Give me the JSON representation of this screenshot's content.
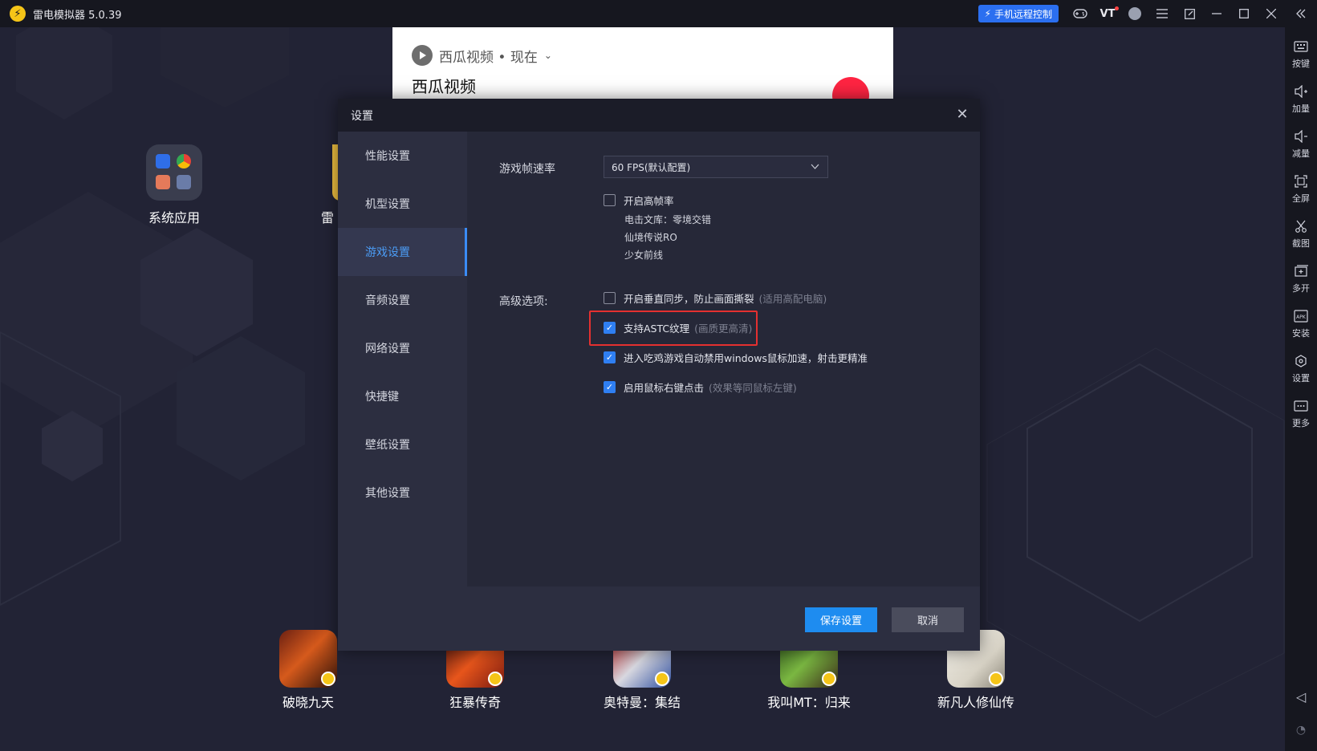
{
  "titlebar": {
    "title": "雷电模拟器 5.0.39",
    "remote_label": "手机远程控制",
    "vt_label": "VT"
  },
  "sidebar": {
    "items": [
      {
        "label": "按键",
        "icon": "keyboard-icon"
      },
      {
        "label": "加量",
        "icon": "volume-up-icon"
      },
      {
        "label": "减量",
        "icon": "volume-down-icon"
      },
      {
        "label": "全屏",
        "icon": "fullscreen-icon"
      },
      {
        "label": "截图",
        "icon": "scissors-icon"
      },
      {
        "label": "多开",
        "icon": "multi-instance-icon"
      },
      {
        "label": "安装",
        "icon": "apk-icon"
      },
      {
        "label": "设置",
        "icon": "gear-icon"
      },
      {
        "label": "更多",
        "icon": "more-icon"
      }
    ]
  },
  "desktop": {
    "folder_label": "系统应用",
    "partial_label": "雷",
    "games": [
      {
        "label": "破晓九天"
      },
      {
        "label": "狂暴传奇"
      },
      {
        "label": "奥特曼：集结"
      },
      {
        "label": "我叫MT：归来"
      },
      {
        "label": "新凡人修仙传"
      }
    ]
  },
  "notification": {
    "source": "西瓜视频 • 现在",
    "title": "西瓜视频"
  },
  "dialog": {
    "title": "设置",
    "nav": [
      {
        "label": "性能设置",
        "active": false
      },
      {
        "label": "机型设置",
        "active": false
      },
      {
        "label": "游戏设置",
        "active": true
      },
      {
        "label": "音频设置",
        "active": false
      },
      {
        "label": "网络设置",
        "active": false
      },
      {
        "label": "快捷键",
        "active": false
      },
      {
        "label": "壁纸设置",
        "active": false
      },
      {
        "label": "其他设置",
        "active": false
      }
    ],
    "fps_label": "游戏帧速率",
    "fps_value": "60 FPS(默认配置)",
    "high_fps": {
      "label": "开启高帧率",
      "checked": false
    },
    "high_fps_games": [
      "电击文库：零境交错",
      "仙境传说RO",
      "少女前线"
    ],
    "advanced_label": "高级选项:",
    "vsync": {
      "label": "开启垂直同步，防止画面撕裂",
      "hint": "(适用高配电脑)",
      "checked": false
    },
    "astc": {
      "label": "支持ASTC纹理",
      "hint": "(画质更高清)",
      "checked": true
    },
    "mouse_accel": {
      "label": "进入吃鸡游戏自动禁用windows鼠标加速，射击更精准",
      "checked": true
    },
    "right_click": {
      "label": "启用鼠标右键点击",
      "hint": "(效果等同鼠标左键)",
      "checked": true
    },
    "save_label": "保存设置",
    "cancel_label": "取消"
  }
}
